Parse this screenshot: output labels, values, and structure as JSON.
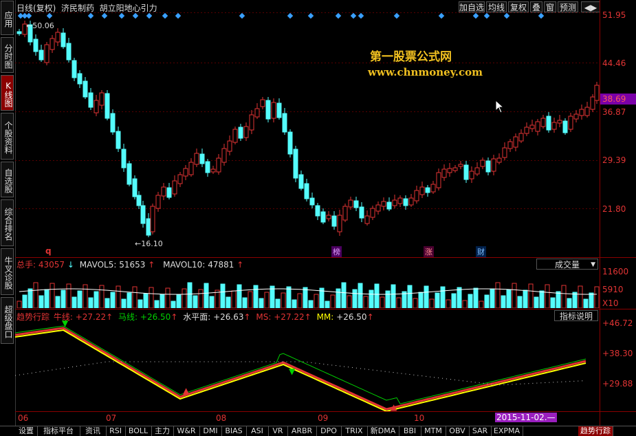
{
  "sidebar": {
    "items": [
      {
        "label": "应用",
        "top": 0
      },
      {
        "label": "分时图",
        "top": 0
      },
      {
        "label": "K线图",
        "top": 0
      },
      {
        "label": "个股资料",
        "top": 0
      },
      {
        "label": "自选股",
        "top": 0
      },
      {
        "label": "综合排名",
        "top": 0
      },
      {
        "label": "牛叉诊股",
        "top": 0
      },
      {
        "label": "超级盘口",
        "top": 0
      }
    ]
  },
  "topbar": {
    "title": "日线(复权)  济民制药  胡立阳地心引力",
    "buttons": [
      "加自选",
      "均线",
      "复权",
      "叠",
      "窗",
      "预测"
    ]
  },
  "watermark": {
    "line1": "第一股票公式网",
    "line2": "www.chnmoney.com"
  },
  "main": {
    "price_axis": [
      "51.95",
      "44.46",
      "36.87",
      "29.39",
      "21.80"
    ],
    "current_price": "38.69",
    "high_label": "50.06",
    "low_label": "16.10",
    "markers": {
      "q": "q",
      "bang": "榜",
      "zhang": "涨",
      "cai": "财"
    }
  },
  "volume": {
    "label_total": "总手:",
    "total": "43057",
    "mavol5_label": "MAVOL5:",
    "mavol5": "51653",
    "mavol10_label": "MAVOL10:",
    "mavol10": "47881",
    "selector": "成交量",
    "axis": [
      "11600",
      "5910",
      "X10"
    ]
  },
  "indicator": {
    "name": "趋势行踪",
    "niu_label": "牛线:",
    "niu": "+27.22",
    "ma_label": "马线:",
    "ma": "+26.50",
    "shuiping_label": "水平面:",
    "shuiping": "+26.63",
    "ms_label": "MS:",
    "ms": "+27.22",
    "mm_label": "MM:",
    "mm": "+26.50",
    "explain_button": "指标说明",
    "axis": [
      "+46.72",
      "+38.30",
      "+29.88"
    ]
  },
  "time_axis": [
    "06",
    "07",
    "08",
    "09",
    "10"
  ],
  "cursor_date": "2015-11-02.—",
  "bottom_tabs": [
    "设置",
    "指标平台",
    "资讯",
    "RSI",
    "BOLL",
    "主力",
    "W&R",
    "DMI",
    "BIAS",
    "ASI",
    "VR",
    "ARBR",
    "DPO",
    "TRIX",
    "新DMA",
    "BBI",
    "MTM",
    "OBV",
    "SAR",
    "EXPMA",
    "趋势行踪"
  ],
  "colors": {
    "up": "#e23434",
    "down": "#54fcfc",
    "yellow": "#ffff00",
    "green": "#00d000",
    "text": "#dddddd"
  }
}
